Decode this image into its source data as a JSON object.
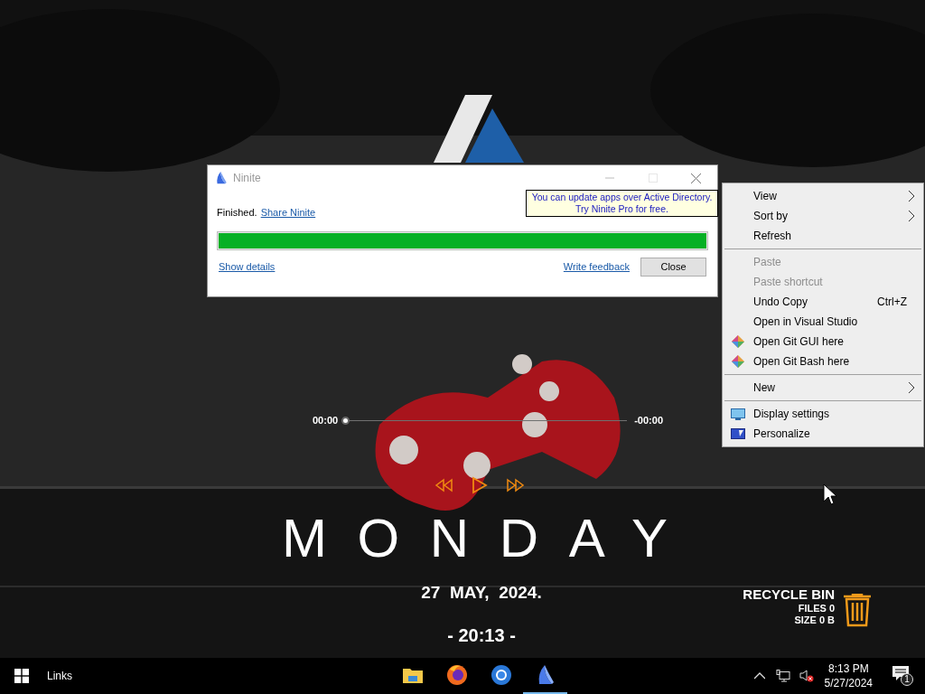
{
  "desktop": {
    "media_player": {
      "elapsed": "00:00",
      "remaining": "-00:00",
      "level": 0
    },
    "day": "MONDAY",
    "date": "27  MAY,  2024.",
    "time": "- 20:13 -",
    "recycle_bin": {
      "title": "RECYCLE BIN",
      "files": "FILES 0",
      "size": "SIZE 0 B"
    }
  },
  "ninite_window": {
    "title": "Ninite",
    "tooltip": [
      "You can update apps over Active Directory.",
      "Try Ninite Pro for free."
    ],
    "status": "Finished.",
    "share_link": "Share Ninite",
    "progress": {
      "level": 1
    },
    "details_link": "Show details",
    "feedback_link": "Write feedback",
    "close_button": "Close"
  },
  "context_menu": {
    "groups": [
      [
        {
          "label": "View",
          "kind": "text",
          "submenu": true,
          "disabled": false
        },
        {
          "label": "Sort by",
          "kind": "text",
          "submenu": true,
          "disabled": false
        },
        {
          "label": "Refresh",
          "kind": "text",
          "submenu": false,
          "disabled": false
        }
      ],
      [
        {
          "label": "Paste",
          "kind": "text",
          "submenu": false,
          "disabled": true
        },
        {
          "label": "Paste shortcut",
          "kind": "text",
          "submenu": false,
          "disabled": true
        },
        {
          "label": "Undo Copy",
          "kind": "text",
          "submenu": false,
          "disabled": false,
          "shortcut": "Ctrl+Z"
        },
        {
          "label": "Open in Visual Studio",
          "kind": "text",
          "submenu": false,
          "disabled": false
        },
        {
          "label": "Open Git GUI here",
          "kind": "git",
          "submenu": false,
          "disabled": false
        },
        {
          "label": "Open Git Bash here",
          "kind": "git",
          "submenu": false,
          "disabled": false
        }
      ],
      [
        {
          "label": "New",
          "kind": "text",
          "submenu": true,
          "disabled": false
        }
      ],
      [
        {
          "label": "Display settings",
          "kind": "display",
          "submenu": false,
          "disabled": false
        },
        {
          "label": "Personalize",
          "kind": "personalize",
          "submenu": false,
          "disabled": false
        }
      ]
    ]
  },
  "taskbar": {
    "search_label": "Links",
    "apps": [
      {
        "kind": "folder",
        "selected": false
      },
      {
        "kind": "firefox",
        "selected": false
      },
      {
        "kind": "browser",
        "selected": false
      },
      {
        "kind": "ninite",
        "selected": true
      }
    ],
    "clock_time": "8:13 PM",
    "clock_date": "5/27/2024",
    "notification_count": "1"
  }
}
